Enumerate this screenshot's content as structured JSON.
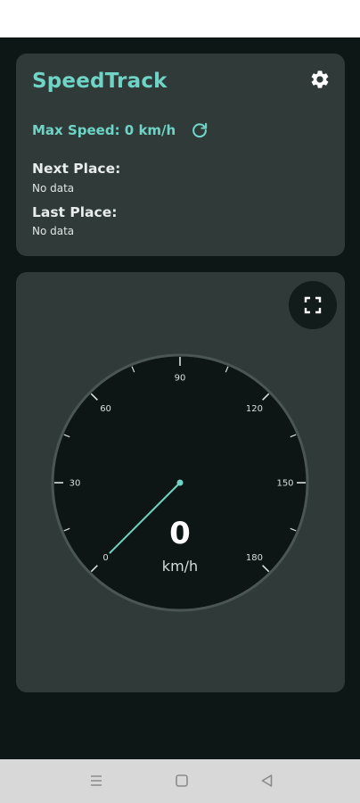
{
  "app": {
    "title": "SpeedTrack"
  },
  "stats": {
    "max_speed_label": "Max Speed: 0 km/h"
  },
  "places": {
    "next_heading": "Next Place:",
    "next_value": "No data",
    "last_heading": "Last Place:",
    "last_value": "No data"
  },
  "gauge": {
    "speed": 0,
    "speed_text": "0",
    "unit": "km/h",
    "min": 0,
    "max": 180,
    "tick_labels": [
      "0",
      "30",
      "60",
      "90",
      "120",
      "150",
      "180"
    ]
  },
  "icons": {
    "settings": "gear-icon",
    "reset": "refresh-icon",
    "fullscreen": "fullscreen-icon",
    "nav_menu": "menu-icon",
    "nav_home": "square-icon",
    "nav_back": "triangle-back-icon"
  },
  "colors": {
    "accent": "#6fd4c6",
    "card": "#2f3a39",
    "background": "#0d1716",
    "dial": "#0e1615"
  }
}
